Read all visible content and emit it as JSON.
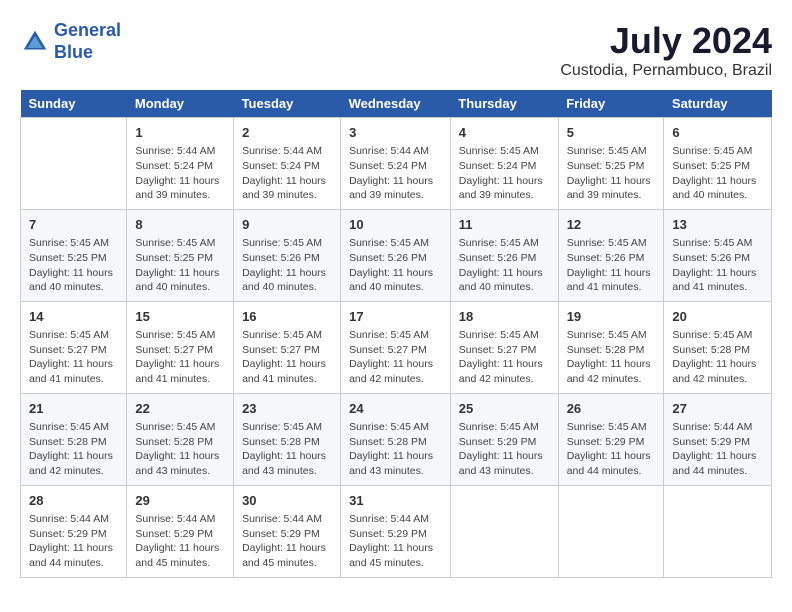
{
  "header": {
    "logo_line1": "General",
    "logo_line2": "Blue",
    "main_title": "July 2024",
    "subtitle": "Custodia, Pernambuco, Brazil"
  },
  "calendar": {
    "days_of_week": [
      "Sunday",
      "Monday",
      "Tuesday",
      "Wednesday",
      "Thursday",
      "Friday",
      "Saturday"
    ],
    "weeks": [
      [
        {
          "day": "",
          "info": ""
        },
        {
          "day": "1",
          "info": "Sunrise: 5:44 AM\nSunset: 5:24 PM\nDaylight: 11 hours\nand 39 minutes."
        },
        {
          "day": "2",
          "info": "Sunrise: 5:44 AM\nSunset: 5:24 PM\nDaylight: 11 hours\nand 39 minutes."
        },
        {
          "day": "3",
          "info": "Sunrise: 5:44 AM\nSunset: 5:24 PM\nDaylight: 11 hours\nand 39 minutes."
        },
        {
          "day": "4",
          "info": "Sunrise: 5:45 AM\nSunset: 5:24 PM\nDaylight: 11 hours\nand 39 minutes."
        },
        {
          "day": "5",
          "info": "Sunrise: 5:45 AM\nSunset: 5:25 PM\nDaylight: 11 hours\nand 39 minutes."
        },
        {
          "day": "6",
          "info": "Sunrise: 5:45 AM\nSunset: 5:25 PM\nDaylight: 11 hours\nand 40 minutes."
        }
      ],
      [
        {
          "day": "7",
          "info": "Sunrise: 5:45 AM\nSunset: 5:25 PM\nDaylight: 11 hours\nand 40 minutes."
        },
        {
          "day": "8",
          "info": "Sunrise: 5:45 AM\nSunset: 5:25 PM\nDaylight: 11 hours\nand 40 minutes."
        },
        {
          "day": "9",
          "info": "Sunrise: 5:45 AM\nSunset: 5:26 PM\nDaylight: 11 hours\nand 40 minutes."
        },
        {
          "day": "10",
          "info": "Sunrise: 5:45 AM\nSunset: 5:26 PM\nDaylight: 11 hours\nand 40 minutes."
        },
        {
          "day": "11",
          "info": "Sunrise: 5:45 AM\nSunset: 5:26 PM\nDaylight: 11 hours\nand 40 minutes."
        },
        {
          "day": "12",
          "info": "Sunrise: 5:45 AM\nSunset: 5:26 PM\nDaylight: 11 hours\nand 41 minutes."
        },
        {
          "day": "13",
          "info": "Sunrise: 5:45 AM\nSunset: 5:26 PM\nDaylight: 11 hours\nand 41 minutes."
        }
      ],
      [
        {
          "day": "14",
          "info": "Sunrise: 5:45 AM\nSunset: 5:27 PM\nDaylight: 11 hours\nand 41 minutes."
        },
        {
          "day": "15",
          "info": "Sunrise: 5:45 AM\nSunset: 5:27 PM\nDaylight: 11 hours\nand 41 minutes."
        },
        {
          "day": "16",
          "info": "Sunrise: 5:45 AM\nSunset: 5:27 PM\nDaylight: 11 hours\nand 41 minutes."
        },
        {
          "day": "17",
          "info": "Sunrise: 5:45 AM\nSunset: 5:27 PM\nDaylight: 11 hours\nand 42 minutes."
        },
        {
          "day": "18",
          "info": "Sunrise: 5:45 AM\nSunset: 5:27 PM\nDaylight: 11 hours\nand 42 minutes."
        },
        {
          "day": "19",
          "info": "Sunrise: 5:45 AM\nSunset: 5:28 PM\nDaylight: 11 hours\nand 42 minutes."
        },
        {
          "day": "20",
          "info": "Sunrise: 5:45 AM\nSunset: 5:28 PM\nDaylight: 11 hours\nand 42 minutes."
        }
      ],
      [
        {
          "day": "21",
          "info": "Sunrise: 5:45 AM\nSunset: 5:28 PM\nDaylight: 11 hours\nand 42 minutes."
        },
        {
          "day": "22",
          "info": "Sunrise: 5:45 AM\nSunset: 5:28 PM\nDaylight: 11 hours\nand 43 minutes."
        },
        {
          "day": "23",
          "info": "Sunrise: 5:45 AM\nSunset: 5:28 PM\nDaylight: 11 hours\nand 43 minutes."
        },
        {
          "day": "24",
          "info": "Sunrise: 5:45 AM\nSunset: 5:28 PM\nDaylight: 11 hours\nand 43 minutes."
        },
        {
          "day": "25",
          "info": "Sunrise: 5:45 AM\nSunset: 5:29 PM\nDaylight: 11 hours\nand 43 minutes."
        },
        {
          "day": "26",
          "info": "Sunrise: 5:45 AM\nSunset: 5:29 PM\nDaylight: 11 hours\nand 44 minutes."
        },
        {
          "day": "27",
          "info": "Sunrise: 5:44 AM\nSunset: 5:29 PM\nDaylight: 11 hours\nand 44 minutes."
        }
      ],
      [
        {
          "day": "28",
          "info": "Sunrise: 5:44 AM\nSunset: 5:29 PM\nDaylight: 11 hours\nand 44 minutes."
        },
        {
          "day": "29",
          "info": "Sunrise: 5:44 AM\nSunset: 5:29 PM\nDaylight: 11 hours\nand 45 minutes."
        },
        {
          "day": "30",
          "info": "Sunrise: 5:44 AM\nSunset: 5:29 PM\nDaylight: 11 hours\nand 45 minutes."
        },
        {
          "day": "31",
          "info": "Sunrise: 5:44 AM\nSunset: 5:29 PM\nDaylight: 11 hours\nand 45 minutes."
        },
        {
          "day": "",
          "info": ""
        },
        {
          "day": "",
          "info": ""
        },
        {
          "day": "",
          "info": ""
        }
      ]
    ]
  }
}
